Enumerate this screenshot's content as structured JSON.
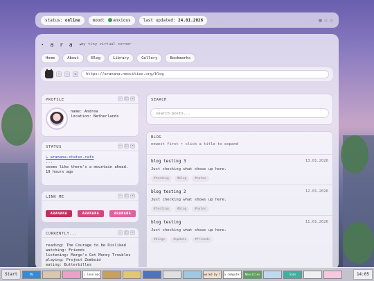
{
  "status_bar": {
    "status_label": "status: ",
    "status_value": "online",
    "mood_label": "mood: ",
    "mood_value": "anxious",
    "updated_label": "last updated: ",
    "updated_value": "24.01.2026"
  },
  "header": {
    "logo": "⋆ a r a ⋆",
    "tagline": "my tiny virtual corner"
  },
  "nav": [
    "Home",
    "About",
    "Blog",
    "Library",
    "Gallery",
    "Bookmarks"
  ],
  "browser": {
    "back": "‹",
    "forward": "›",
    "refresh": "↻",
    "url": "https://aranana.neocities.org/blog"
  },
  "profile": {
    "title": "PROFILE",
    "name": "name: Andrea",
    "location": "location: Netherlands"
  },
  "status_panel": {
    "title": "STATUS",
    "link": "↳ aranana.status.cafe",
    "dots": "...",
    "message": "seems like there's a mountain ahead.",
    "time": "19 hours ago"
  },
  "link_me": {
    "title": "LINK ME",
    "badges": [
      {
        "text": "ARANANA",
        "color": "#c0305a"
      },
      {
        "text": "ARANANA",
        "color": "#d0487a"
      },
      {
        "text": "ARANANA",
        "color": "#e060a0"
      }
    ]
  },
  "currently": {
    "title": "CURRENTLY...",
    "lines": [
      "reading: The Courage to be Disliked",
      "watching: Friends",
      "listening: Margo's Got Money Troubles",
      "playing: Project Zomboid",
      "eating: Butterbilles"
    ]
  },
  "search": {
    "title": "SEARCH",
    "placeholder": "search posts..."
  },
  "blog": {
    "title": "BLOG",
    "subtitle": "newest first • click a title to expand",
    "posts": [
      {
        "title": "blog testing 3",
        "date": "13.01.2026",
        "body": "Just checking what shows up here.",
        "tags": [
          "#testing",
          "#blog",
          "#notes"
        ]
      },
      {
        "title": "blog testing 2",
        "date": "12.01.2026",
        "body": "Just checking what shows up here.",
        "tags": [
          "#testing",
          "#blog",
          "#notes"
        ]
      },
      {
        "title": "blog testing",
        "date": "11.01.2026",
        "body": "Just checking what shows up here.",
        "tags": [
          "#blogs",
          "#update",
          "#friends"
        ]
      }
    ]
  },
  "panel_controls": [
    "–",
    "□",
    "×"
  ],
  "taskbar": {
    "start": "Start",
    "buttons": [
      "MS",
      "",
      "",
      "i love mac",
      "",
      "",
      "",
      "",
      "",
      "powered by TEA",
      "a computer",
      "Neocities",
      "",
      "Sims",
      "",
      "",
      ""
    ],
    "clock": "14:05"
  }
}
